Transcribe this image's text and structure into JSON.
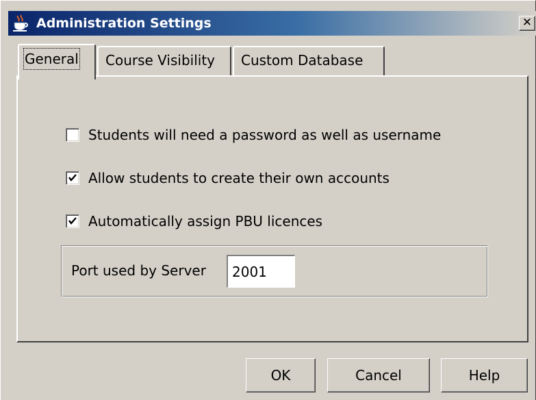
{
  "window": {
    "title": "Administration Settings",
    "close_label": "✕",
    "icon": "java-cup-icon"
  },
  "tabs": [
    {
      "label": "General",
      "active": true
    },
    {
      "label": "Course Visibility",
      "active": false
    },
    {
      "label": "Custom Database",
      "active": false
    }
  ],
  "general": {
    "options": [
      {
        "label": "Students will need a password as well as username",
        "checked": false
      },
      {
        "label": "Allow students to create their own accounts",
        "checked": true
      },
      {
        "label": "Automatically assign PBU licences",
        "checked": true
      }
    ],
    "port": {
      "label": "Port used by Server",
      "value": "2001"
    }
  },
  "buttons": {
    "ok": "OK",
    "cancel": "Cancel",
    "help": "Help"
  },
  "colors": {
    "titlebar_start": "#0a246a",
    "titlebar_end": "#d4d0c8",
    "face": "#d4d0c8"
  }
}
